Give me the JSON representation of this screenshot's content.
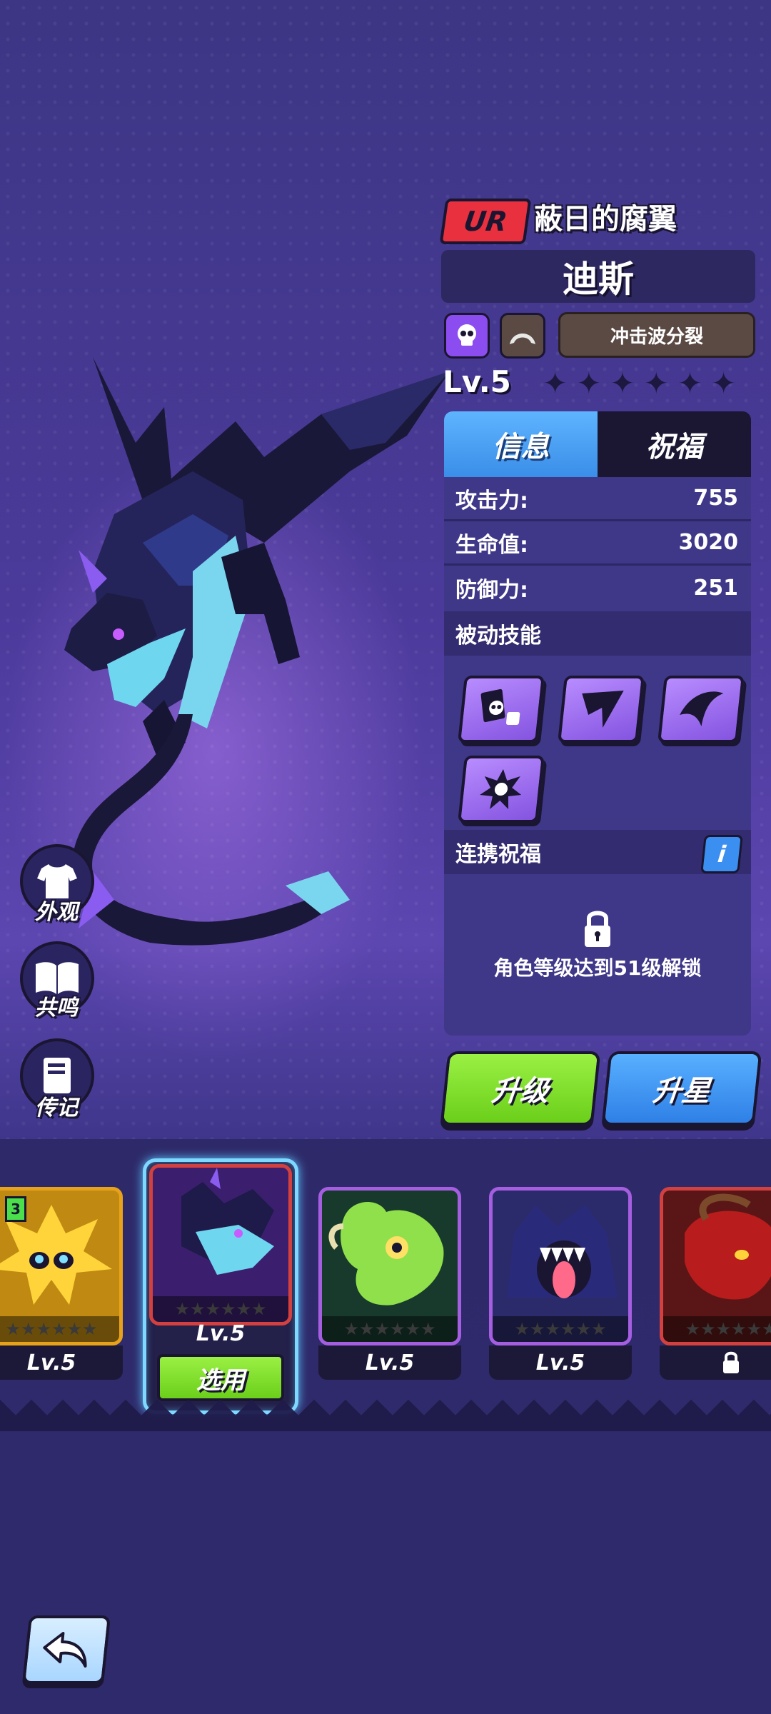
{
  "hero": {
    "rarity": "UR",
    "title": "蔽日的腐翼",
    "name": "迪斯",
    "skill_name": "冲击波分裂",
    "level": "Lv.5",
    "stars_total": 6,
    "stars_filled": 0
  },
  "tabs": [
    {
      "label": "信息",
      "active": true
    },
    {
      "label": "祝福",
      "active": false
    }
  ],
  "stats": [
    {
      "label": "攻击力:",
      "value": "755"
    },
    {
      "label": "生命值:",
      "value": "3020"
    },
    {
      "label": "防御力:",
      "value": "251"
    }
  ],
  "passive_section": {
    "title": "被动技能",
    "skills": [
      "card-skull-skill-icon",
      "dark-wing-skill-icon",
      "dark-wing-skill-icon",
      "skull-burst-skill-icon"
    ]
  },
  "link_blessing": {
    "title": "连携祝福",
    "info_label": "i",
    "lock_message": "角色等级达到51级解锁"
  },
  "buttons": {
    "upgrade": "升级",
    "star_up": "升星",
    "select": "选用"
  },
  "side_menu": [
    {
      "label": "外观",
      "icon": "shirt-icon"
    },
    {
      "label": "共鸣",
      "icon": "book-icon"
    },
    {
      "label": "传记",
      "icon": "notebook-icon"
    }
  ],
  "roster": [
    {
      "name": "yellow-spiky-creature",
      "level": "Lv.5",
      "frame_color": "#e8a21a",
      "bg": "#c08a12",
      "locked": false,
      "badge": "3"
    },
    {
      "name": "dark-dragon",
      "level": "Lv.5",
      "frame_color": "#d24040",
      "bg": "#3b1f6e",
      "locked": false,
      "selected": true
    },
    {
      "name": "green-dino",
      "level": "Lv.5",
      "frame_color": "#a55ee0",
      "bg": "#173a2c",
      "locked": false
    },
    {
      "name": "wolf-monster",
      "level": "Lv.5",
      "frame_color": "#a55ee0",
      "bg": "#2b2a6a",
      "locked": false
    },
    {
      "name": "red-demon",
      "level": "",
      "frame_color": "#d24040",
      "bg": "#5a1616",
      "locked": true
    }
  ],
  "colors": {
    "rarity_red": "#e8303e",
    "tab_blue": "#3a8ee8",
    "upgrade_green": "#7ada2a",
    "select_glow": "#7fd8ff"
  }
}
